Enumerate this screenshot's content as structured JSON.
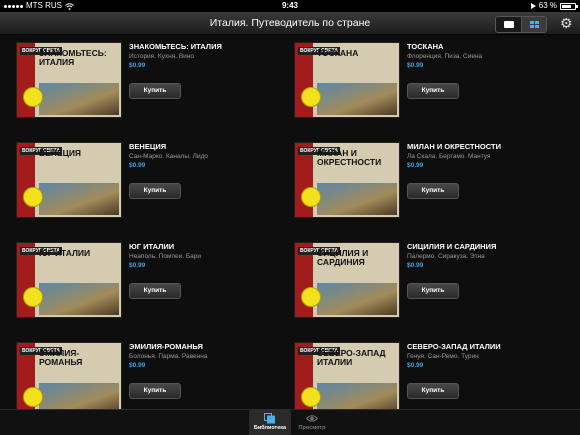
{
  "statusbar": {
    "carrier": "MTS RUS",
    "time": "9:43",
    "battery_percent": "63 %",
    "battery_level": 0.63
  },
  "navbar": {
    "title": "Италия. Путеводитель по стране",
    "view_modes": [
      "single-view-icon",
      "grid-view-icon"
    ],
    "settings_icon": "gear-icon"
  },
  "items": [
    {
      "cover_brand": "ВОКРУГ СВЕТА",
      "cover_title": "Знакомьтесь: Италия",
      "title": "ЗНАКОМЬТЕСЬ: ИТАЛИЯ",
      "subtitle": "История. Кухня. Вино",
      "price": "$0.99",
      "buy_label": "Купить"
    },
    {
      "cover_brand": "ВОКРУГ СВЕТА",
      "cover_title": "Тоскана",
      "title": "ТОСКАНА",
      "subtitle": "Флоренция. Пиза. Сиена",
      "price": "$0.99",
      "buy_label": "Купить"
    },
    {
      "cover_brand": "ВОКРУГ СВЕТА",
      "cover_title": "Венеция",
      "title": "ВЕНЕЦИЯ",
      "subtitle": "Сан-Марко. Каналы. Лидо",
      "price": "$0.99",
      "buy_label": "Купить"
    },
    {
      "cover_brand": "ВОКРУГ СВЕТА",
      "cover_title": "Милан и окрестности",
      "title": "МИЛАН И ОКРЕСТНОСТИ",
      "subtitle": "Ла Скала. Бергамо. Мантуя",
      "price": "$0.99",
      "buy_label": "Купить"
    },
    {
      "cover_brand": "ВОКРУГ СВЕТА",
      "cover_title": "Юг Италии",
      "title": "ЮГ ИТАЛИИ",
      "subtitle": "Неаполь. Помпеи. Бари",
      "price": "$0.99",
      "buy_label": "Купить"
    },
    {
      "cover_brand": "ВОКРУГ СВЕТА",
      "cover_title": "Сицилия и Сардиния",
      "title": "СИЦИЛИЯ И САРДИНИЯ",
      "subtitle": "Палермо. Сиракуза. Этна",
      "price": "$0.99",
      "buy_label": "Купить"
    },
    {
      "cover_brand": "ВОКРУГ СВЕТА",
      "cover_title": "Эмилия-Романья",
      "title": "ЭМИЛИЯ-РОМАНЬЯ",
      "subtitle": "Болонья. Парма. Равенна",
      "price": "$0.99",
      "buy_label": "Купить"
    },
    {
      "cover_brand": "ВОКРУГ СВЕТА",
      "cover_title": "Северо-Запад Италии",
      "title": "СЕВЕРО-ЗАПАД ИТАЛИИ",
      "subtitle": "Генуя. Сан-Ремо. Турин",
      "price": "$0.99",
      "buy_label": "Купить"
    }
  ],
  "tabbar": {
    "library_label": "Библиотека",
    "viewer_label": "Просмотр",
    "library_icon": "library-icon",
    "viewer_icon": "eye-icon"
  },
  "colors": {
    "accent": "#3aa4e6",
    "cover_spine": "#a31c1c",
    "background": "#0e0e0e"
  }
}
